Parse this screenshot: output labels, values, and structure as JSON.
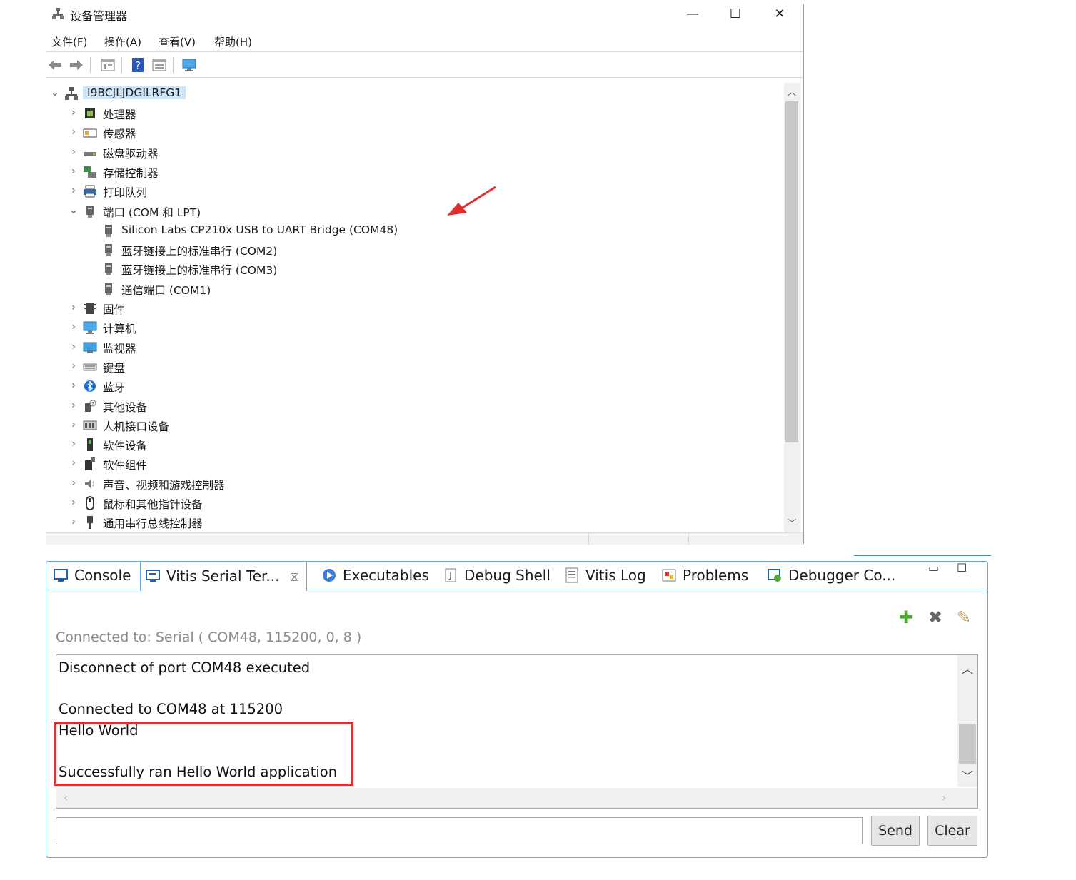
{
  "device_manager": {
    "title": "设备管理器",
    "window_controls": {
      "minimize": "—",
      "maximize": "☐",
      "close": "✕"
    },
    "menu": [
      "文件(F)",
      "操作(A)",
      "查看(V)",
      "帮助(H)"
    ],
    "root": "I9BCJLJDGILRFG1",
    "categories": [
      {
        "label": "处理器",
        "icon": "cpu-icon"
      },
      {
        "label": "传感器",
        "icon": "sensor-icon"
      },
      {
        "label": "磁盘驱动器",
        "icon": "disk-icon"
      },
      {
        "label": "存储控制器",
        "icon": "storage-controller-icon"
      },
      {
        "label": "打印队列",
        "icon": "printer-icon"
      },
      {
        "label": "端口 (COM 和 LPT)",
        "icon": "port-icon",
        "expanded": true,
        "children": [
          "Silicon Labs CP210x USB to UART Bridge (COM48)",
          "蓝牙链接上的标准串行 (COM2)",
          "蓝牙链接上的标准串行 (COM3)",
          "通信端口 (COM1)"
        ]
      },
      {
        "label": "固件",
        "icon": "firmware-icon"
      },
      {
        "label": "计算机",
        "icon": "computer-icon"
      },
      {
        "label": "监视器",
        "icon": "monitor-icon"
      },
      {
        "label": "键盘",
        "icon": "keyboard-icon"
      },
      {
        "label": "蓝牙",
        "icon": "bluetooth-icon"
      },
      {
        "label": "其他设备",
        "icon": "other-devices-icon"
      },
      {
        "label": "人机接口设备",
        "icon": "hid-icon"
      },
      {
        "label": "软件设备",
        "icon": "software-device-icon"
      },
      {
        "label": "软件组件",
        "icon": "software-component-icon"
      },
      {
        "label": "声音、视频和游戏控制器",
        "icon": "speaker-icon"
      },
      {
        "label": "鼠标和其他指针设备",
        "icon": "mouse-icon"
      },
      {
        "label": "通用串行总线控制器",
        "icon": "usb-icon"
      }
    ]
  },
  "vitis": {
    "tabs": [
      {
        "label": "Console",
        "icon": "console-icon"
      },
      {
        "label": "Vitis Serial Ter...",
        "icon": "serial-terminal-icon",
        "active": true,
        "close": "☒"
      },
      {
        "label": "Executables",
        "icon": "executables-icon"
      },
      {
        "label": "Debug Shell",
        "icon": "debug-shell-icon"
      },
      {
        "label": "Vitis Log",
        "icon": "log-icon"
      },
      {
        "label": "Problems",
        "icon": "problems-icon"
      },
      {
        "label": "Debugger Co...",
        "icon": "debugger-console-icon"
      }
    ],
    "connected_label": "Connected to: Serial (  COM48, 115200, 0, 8 )",
    "terminal_lines": [
      "Disconnect of port COM48 executed",
      "Connected to COM48 at 115200",
      "Hello World",
      "Successfully ran Hello World application"
    ],
    "send_input": {
      "value": "",
      "placeholder": ""
    },
    "send_label": "Send",
    "clear_label": "Clear"
  },
  "colors": {
    "accent": "#6aa6de",
    "highlight_box": "#e02d2d",
    "annotation_arrow": "#e02d2d"
  }
}
